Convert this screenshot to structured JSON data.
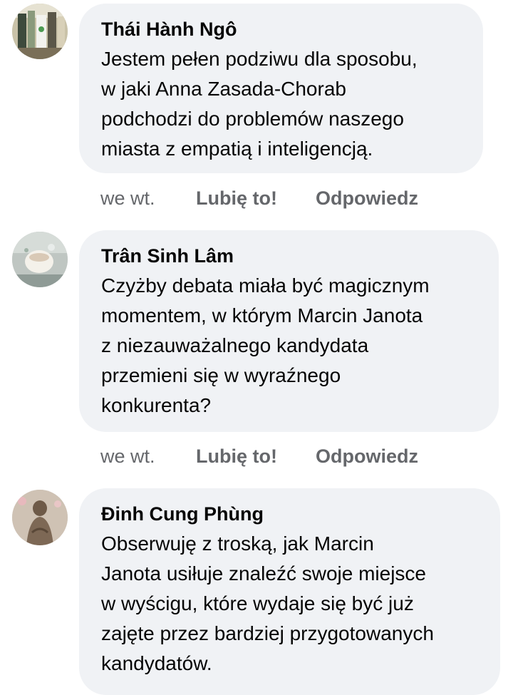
{
  "comments": [
    {
      "author": "Thái Hành Ngô",
      "lines": [
        "Jestem pełen podziwu dla sposobu,",
        "w jaki Anna Zasada-Chorab",
        "podchodzi do problemów naszego",
        "miasta z empatią i inteligencją."
      ],
      "time": "we wt.",
      "like_label": "Lubię to!",
      "reply_label": "Odpowiedz",
      "avatar_icon": "profile-photo-shelves"
    },
    {
      "author": "Trân Sinh Lâm",
      "lines": [
        "Czyżby debata miała być magicznym",
        "momentem, w którym Marcin Janota",
        "z niezauważalnego kandydata",
        "przemieni się w wyraźnego",
        "konkurenta?"
      ],
      "time": "we wt.",
      "like_label": "Lubię to!",
      "reply_label": "Odpowiedz",
      "avatar_icon": "profile-photo-cup"
    },
    {
      "author": "Đinh Cung Phùng",
      "lines": [
        "Obserwuję z troską, jak Marcin",
        "Janota usiłuje znaleźć swoje miejsce",
        "w wyścigu, które wydaje się być już",
        "zajęte przez bardziej przygotowanych",
        "kandydatów."
      ],
      "avatar_icon": "profile-photo-statue"
    }
  ],
  "colors": {
    "bubble": "#f0f2f5",
    "text": "#050505",
    "meta": "#65676b"
  }
}
